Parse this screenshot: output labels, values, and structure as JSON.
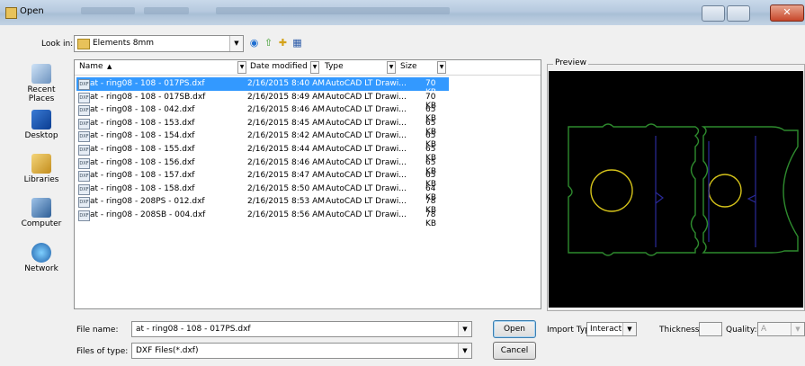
{
  "window": {
    "title": "Open"
  },
  "lookin": {
    "label": "Look in:",
    "value": "Elements 8mm"
  },
  "places": [
    {
      "label": "Recent Places",
      "icon": "recent-places-icon"
    },
    {
      "label": "Desktop",
      "icon": "desktop-icon"
    },
    {
      "label": "Libraries",
      "icon": "libraries-icon"
    },
    {
      "label": "Computer",
      "icon": "computer-icon"
    },
    {
      "label": "Network",
      "icon": "network-icon"
    }
  ],
  "columns": {
    "name": "Name",
    "date": "Date modified",
    "type": "Type",
    "size": "Size"
  },
  "files": [
    {
      "name": "at - ring08 - 108 - 017PS.dxf",
      "date": "2/16/2015 8:40 AM",
      "type": "AutoCAD LT Drawi...",
      "size": "70 KB",
      "selected": true
    },
    {
      "name": "at - ring08 - 108 - 017SB.dxf",
      "date": "2/16/2015 8:49 AM",
      "type": "AutoCAD LT Drawi...",
      "size": "70 KB"
    },
    {
      "name": "at - ring08 - 108 - 042.dxf",
      "date": "2/16/2015 8:46 AM",
      "type": "AutoCAD LT Drawi...",
      "size": "65 KB"
    },
    {
      "name": "at - ring08 - 108 - 153.dxf",
      "date": "2/16/2015 8:45 AM",
      "type": "AutoCAD LT Drawi...",
      "size": "65 KB"
    },
    {
      "name": "at - ring08 - 108 - 154.dxf",
      "date": "2/16/2015 8:42 AM",
      "type": "AutoCAD LT Drawi...",
      "size": "65 KB"
    },
    {
      "name": "at - ring08 - 108 - 155.dxf",
      "date": "2/16/2015 8:44 AM",
      "type": "AutoCAD LT Drawi...",
      "size": "65 KB"
    },
    {
      "name": "at - ring08 - 108 - 156.dxf",
      "date": "2/16/2015 8:46 AM",
      "type": "AutoCAD LT Drawi...",
      "size": "65 KB"
    },
    {
      "name": "at - ring08 - 108 - 157.dxf",
      "date": "2/16/2015 8:47 AM",
      "type": "AutoCAD LT Drawi...",
      "size": "65 KB"
    },
    {
      "name": "at - ring08 - 108 - 158.dxf",
      "date": "2/16/2015 8:50 AM",
      "type": "AutoCAD LT Drawi...",
      "size": "64 KB"
    },
    {
      "name": "at - ring08 - 208PS - 012.dxf",
      "date": "2/16/2015 8:53 AM",
      "type": "AutoCAD LT Drawi...",
      "size": "78 KB"
    },
    {
      "name": "at - ring08 - 208SB - 004.dxf",
      "date": "2/16/2015 8:56 AM",
      "type": "AutoCAD LT Drawi...",
      "size": "78 KB"
    }
  ],
  "preview": {
    "label": "Preview"
  },
  "filename": {
    "label": "File name:",
    "value": "at - ring08 - 108 - 017PS.dxf"
  },
  "filetype": {
    "label": "Files of type:",
    "value": "DXF Files(*.dxf)"
  },
  "buttons": {
    "open": "Open",
    "cancel": "Cancel"
  },
  "import": {
    "label": "Import Type:",
    "value": "Interactive"
  },
  "thickness": {
    "label": "Thickness:",
    "value": ""
  },
  "quality": {
    "label": "Quality:",
    "value": "A"
  },
  "colors": {
    "selection": "#3399ff",
    "outline": "#2e8b2e",
    "circle": "#d4c21a",
    "divider": "#2a2a9a"
  }
}
